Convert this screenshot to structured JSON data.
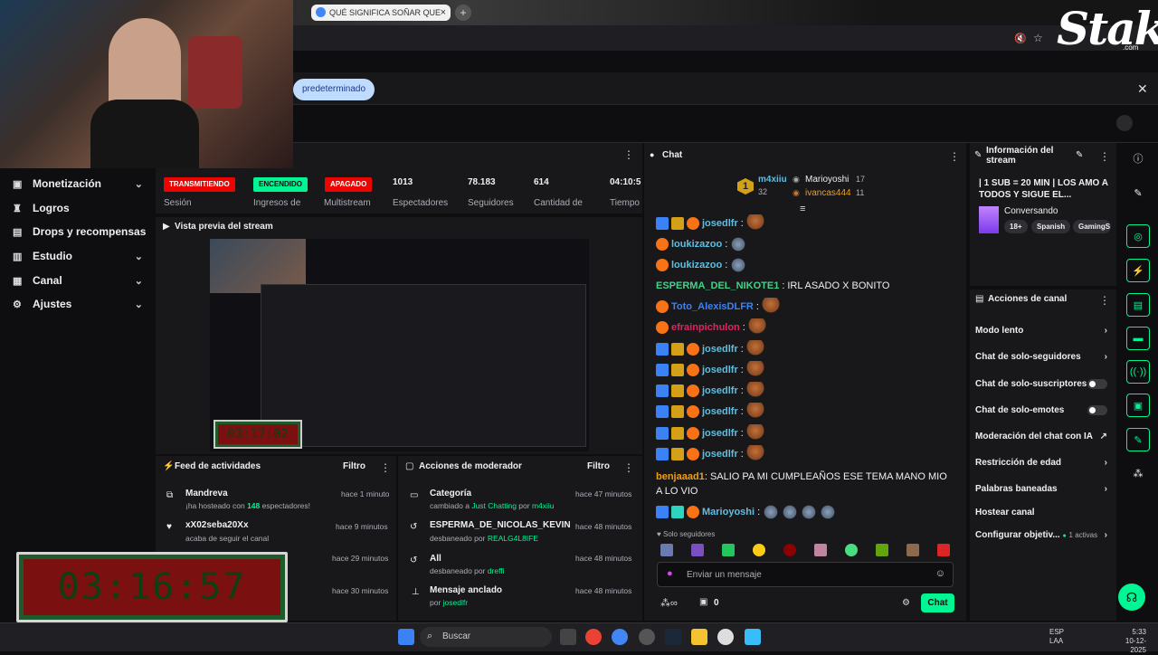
{
  "browser": {
    "tab_title": "QUÉ SIGNIFICA SOÑAR QUE TE",
    "notice_pill": "predeterminado",
    "brand": "Stake",
    "brand_sub": ".com"
  },
  "sidebar": {
    "items": [
      {
        "label": "Monetización",
        "icon": "dollar-icon",
        "expandable": true
      },
      {
        "label": "Logros",
        "icon": "trophy-icon",
        "expandable": false
      },
      {
        "label": "Drops y recompensas",
        "icon": "gift-icon",
        "expandable": false
      },
      {
        "label": "Estudio",
        "icon": "chart-icon",
        "expandable": true
      },
      {
        "label": "Canal",
        "icon": "broadcast-icon",
        "expandable": true
      },
      {
        "label": "Ajustes",
        "icon": "gear-icon",
        "expandable": true
      }
    ]
  },
  "stats": {
    "session_badge": "TRANSMITIENDO",
    "session_label": "Sesión",
    "income_badge": "ENCENDIDO",
    "income_label": "Ingresos de",
    "multi_badge": "APAGADO",
    "multi_label": "Multistream",
    "viewers": "1013",
    "viewers_label": "Espectadores",
    "followers": "78.183",
    "followers_label": "Seguidores",
    "amount": "614",
    "amount_label": "Cantidad de",
    "time": "04:10:5",
    "time_label": "Tiempo"
  },
  "preview": {
    "title": "Vista previa del stream",
    "timer": "03:17:02"
  },
  "activity_feed": {
    "title": "Feed de actividades",
    "filter": "Filtro",
    "items": [
      {
        "name": "Mandreva",
        "sub_pre": "¡ha hosteado con ",
        "sub_num": "148",
        "sub_post": " espectadores!",
        "time": "hace 1 minuto",
        "icon": "host-icon"
      },
      {
        "name": "xX02seba20Xx",
        "sub": "acaba de seguir el canal",
        "time": "hace 9 minutos",
        "icon": "heart-icon"
      },
      {
        "name": "",
        "sub": "",
        "time": "hace 29 minutos",
        "icon": ""
      },
      {
        "name": "",
        "sub": "",
        "time": "hace 30 minutos",
        "icon": ""
      }
    ]
  },
  "mod_actions": {
    "title": "Acciones de moderador",
    "filter": "Filtro",
    "items": [
      {
        "name": "Categoría",
        "sub_pre": "cambiado a ",
        "sub_hl": "Just Chatting",
        "sub_mid": " por ",
        "sub_user": "m4xiiu",
        "time": "hace 47 minutos",
        "icon": "category-icon"
      },
      {
        "name": "ESPERMA_DE_NICOLAS_KEVIN",
        "sub_pre": "desbaneado por ",
        "sub_user": "REALG4L8IFE",
        "time": "hace 48 minutos",
        "icon": "undo-icon"
      },
      {
        "name": "All",
        "sub_pre": "desbaneado por ",
        "sub_user": "dreffi",
        "time": "hace 48 minutos",
        "icon": "undo-icon"
      },
      {
        "name": "Mensaje anclado",
        "sub_pre": "por ",
        "sub_user": "josedlfr",
        "time": "hace 48 minutos",
        "icon": "pin-icon"
      }
    ]
  },
  "chat": {
    "title": "Chat",
    "top_gifters": {
      "first": "m4xiiu",
      "first_count": "32",
      "second": "Marioyoshi",
      "second_count": "17",
      "third": "ivancas444",
      "third_count": "11"
    },
    "messages": [
      {
        "user": "josedlfr",
        "color": "#5fbfe0",
        "text": ""
      },
      {
        "user": "loukizazoo",
        "color": "#5fbfe0",
        "text": ""
      },
      {
        "user": "loukizazoo",
        "color": "#5fbfe0",
        "text": ""
      },
      {
        "user": "ESPERMA_DEL_NIKOTE1",
        "color": "#45d18a",
        "text": "IRL ASADO X BONITO"
      },
      {
        "user": "Toto_AlexisDLFR",
        "color": "#3b82f6",
        "text": ""
      },
      {
        "user": "efrainpichulon",
        "color": "#e0245e",
        "text": ""
      },
      {
        "user": "josedlfr",
        "color": "#5fbfe0",
        "text": ""
      },
      {
        "user": "josedlfr",
        "color": "#5fbfe0",
        "text": ""
      },
      {
        "user": "josedlfr",
        "color": "#5fbfe0",
        "text": ""
      },
      {
        "user": "josedlfr",
        "color": "#5fbfe0",
        "text": ""
      },
      {
        "user": "josedlfr",
        "color": "#5fbfe0",
        "text": ""
      },
      {
        "user": "josedlfr",
        "color": "#5fbfe0",
        "text": ""
      },
      {
        "user": "benjaaad1",
        "color": "#f59e0b",
        "text": "SALIO PA MI CUMPLEAÑOS ESE TEMA MANO MIO A LO VIO"
      },
      {
        "user": "Marioyoshi",
        "color": "#5fbfe0",
        "text": ""
      }
    ],
    "followers_only": "Solo seguidores",
    "input_placeholder": "Enviar un mensaje",
    "points": "0",
    "send": "Chat"
  },
  "stream_info": {
    "title": "Información del stream",
    "stream_title": "| 1 SUB = 20 MIN | LOS AMO A TODOS Y SIGUE EL...",
    "category": "Conversando",
    "tags": [
      "18+",
      "Spanish",
      "GamingS"
    ]
  },
  "channel_actions": {
    "title": "Acciones de canal",
    "items": [
      {
        "label": "Modo lento",
        "kind": "chevron"
      },
      {
        "label": "Chat de solo-seguidores",
        "kind": "chevron"
      },
      {
        "label": "Chat de solo-suscriptores",
        "kind": "toggle"
      },
      {
        "label": "Chat de solo-emotes",
        "kind": "toggle"
      },
      {
        "label": "Moderación del chat con IA",
        "kind": "external"
      },
      {
        "label": "Restricción de edad",
        "kind": "chevron"
      },
      {
        "label": "Palabras baneadas",
        "kind": "chevron"
      },
      {
        "label": "Hostear canal",
        "kind": "none"
      },
      {
        "label": "Configurar objetiv...",
        "kind": "goal",
        "extra": "1 activas"
      }
    ]
  },
  "overlay_timer": "03:16:57",
  "taskbar": {
    "search": "Buscar",
    "lang1": "ESP",
    "lang2": "LAA",
    "time": "5:33",
    "date": "10-12-2025"
  }
}
